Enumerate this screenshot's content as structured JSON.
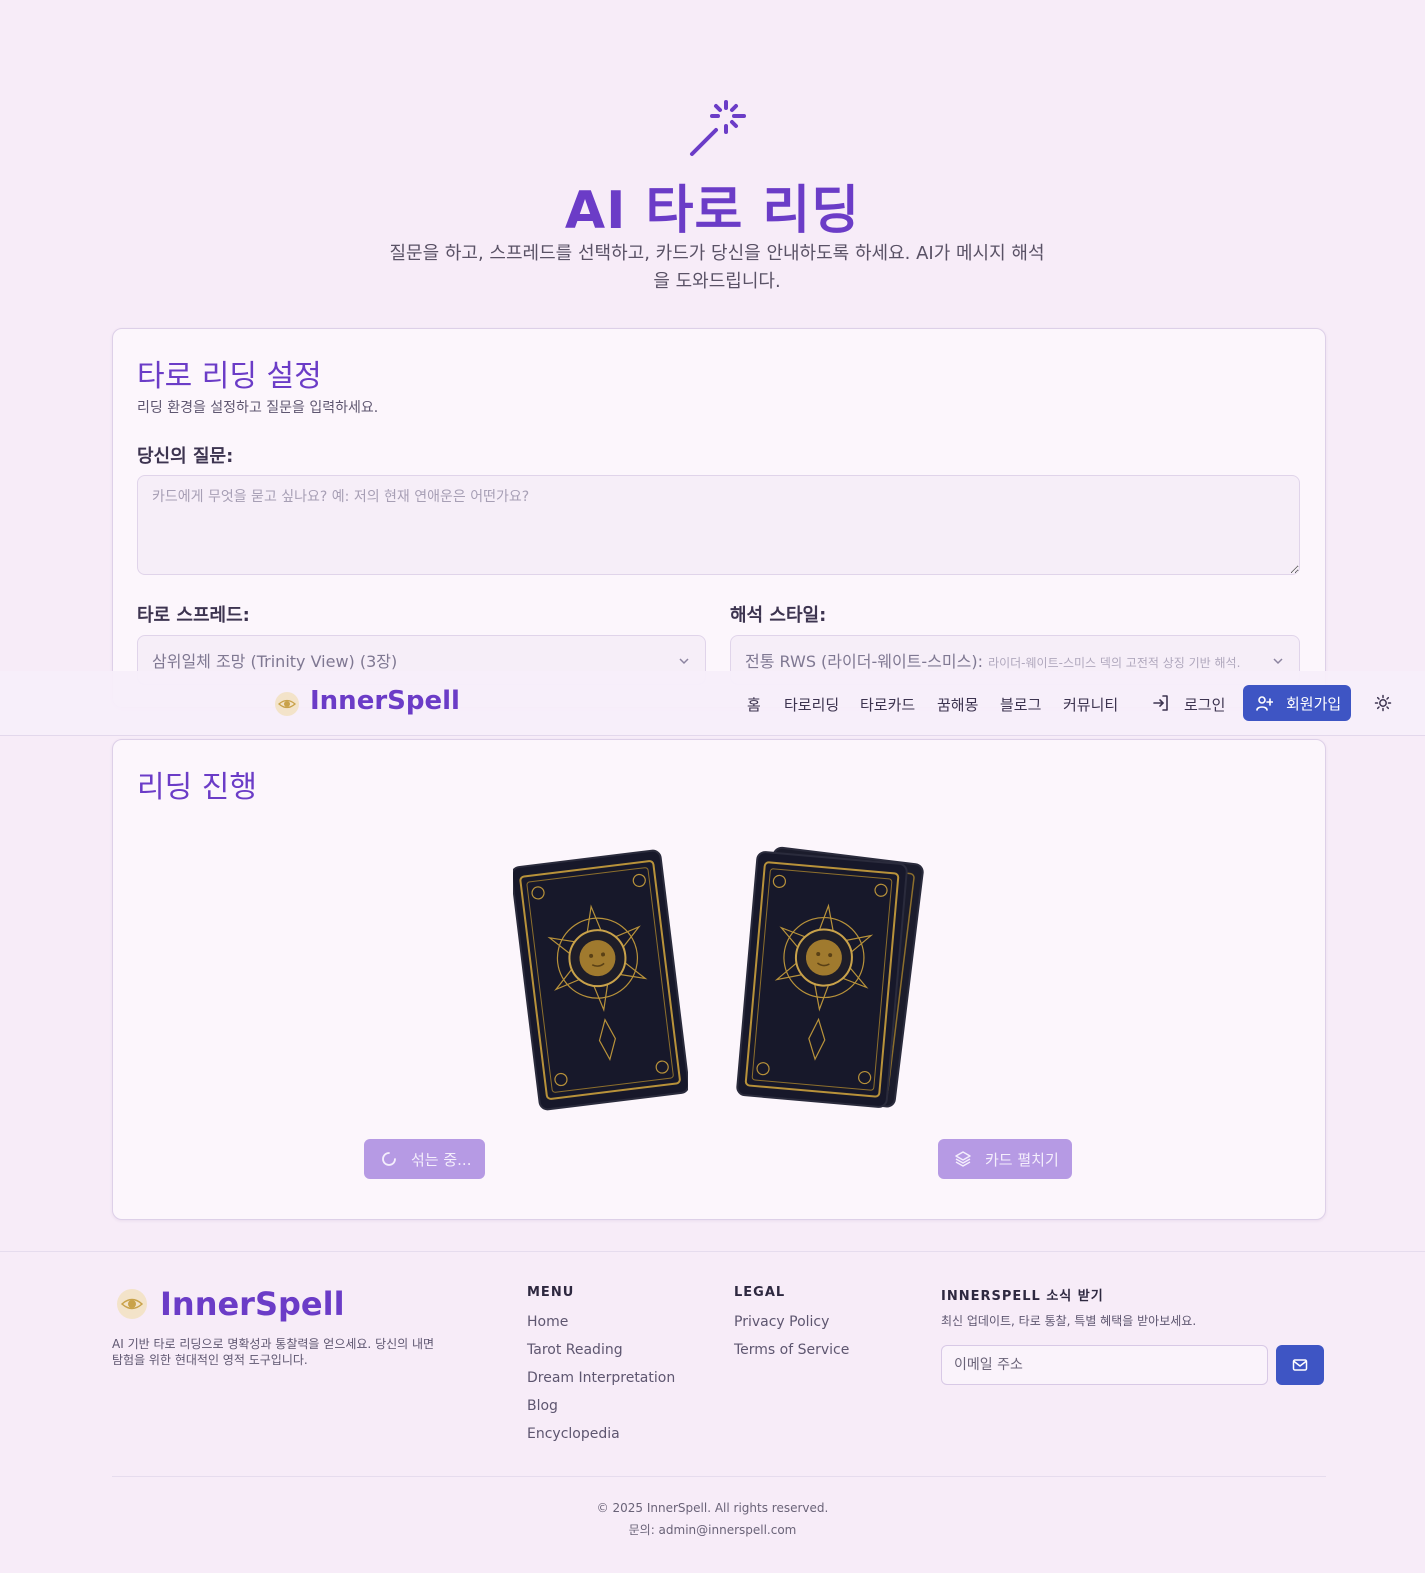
{
  "hero": {
    "title": "AI 타로 리딩",
    "subtitle": "질문을 하고, 스프레드를 선택하고, 카드가 당신을 안내하도록 하세요. AI가 메시지 해석을 도와드립니다."
  },
  "settings": {
    "title": "타로 리딩 설정",
    "description": "리딩 환경을 설정하고 질문을 입력하세요.",
    "question_label": "당신의 질문:",
    "question_placeholder": "카드에게 무엇을 묻고 싶나요? 예: 저의 현재 연애운은 어떤가요?",
    "question_value": "",
    "spread_label": "타로 스프레드:",
    "spread_value": "삼위일체 조망 (Trinity View) (3장)",
    "style_label": "해석 스타일:",
    "style_value": "전통 RWS (라이더-웨이트-스미스):",
    "style_value_desc": "라이더-웨이트-스미스 덱의 고전적 상징 기반 해석."
  },
  "navbar": {
    "brand": "InnerSpell",
    "links": [
      "홈",
      "타로리딩",
      "타로카드",
      "꿈해몽",
      "블로그",
      "커뮤니티"
    ],
    "login": "로그인",
    "signup": "회원가입"
  },
  "progress": {
    "title": "리딩 진행",
    "shuffle_button": "섞는 중...",
    "spread_button": "카드 펼치기"
  },
  "footer": {
    "brand": "InnerSpell",
    "description": "AI 기반 타로 리딩으로 명확성과 통찰력을 얻으세요. 당신의 내면 탐험을 위한 현대적인 영적 도구입니다.",
    "menu_heading": "MENU",
    "menu_links": [
      "Home",
      "Tarot Reading",
      "Dream Interpretation",
      "Blog",
      "Encyclopedia"
    ],
    "legal_heading": "LEGAL",
    "legal_links": [
      "Privacy Policy",
      "Terms of Service"
    ],
    "newsletter_heading": "INNERSPELL 소식 받기",
    "newsletter_desc": "최신 업데이트, 타로 통찰, 특별 혜택을 받아보세요.",
    "email_placeholder": "이메일 주소",
    "copyright": "© 2025 InnerSpell. All rights reserved.",
    "contact": "문의: admin@innerspell.com"
  },
  "colors": {
    "brand_purple": "#6b3cc7",
    "button_blue": "#3e55c4",
    "button_lavender": "#b69ae4",
    "page_bg": "#f7ecf8"
  },
  "icons": [
    "magic-wand-icon",
    "chevron-down-icon",
    "logo-eye-icon",
    "login-icon",
    "user-plus-icon",
    "sun-icon",
    "loader-icon",
    "layers-icon",
    "mail-icon"
  ]
}
